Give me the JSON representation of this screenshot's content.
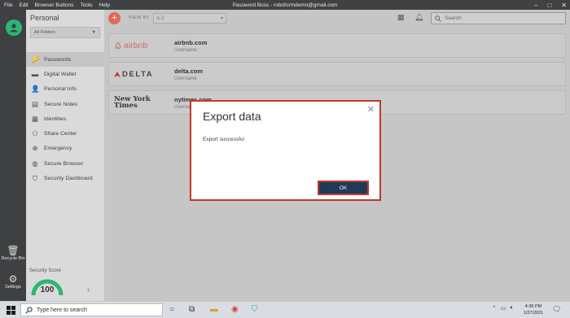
{
  "window": {
    "title": "Password Boss - roboformdemo@gmail.com",
    "menu": [
      "File",
      "Edit",
      "Browser Buttons",
      "Tools",
      "Help"
    ],
    "controls": [
      "–",
      "□",
      "✕"
    ]
  },
  "rail": {
    "recycle_label": "Recycle Bin",
    "settings_label": "Settings"
  },
  "sidebar": {
    "title": "Personal",
    "folder_filter": "All Folders",
    "items": [
      {
        "label": "Passwords",
        "icon": "key-icon",
        "glyph": "🔑",
        "active": true
      },
      {
        "label": "Digital Wallet",
        "icon": "wallet-icon",
        "glyph": "▬"
      },
      {
        "label": "Personal Info",
        "icon": "person-icon",
        "glyph": "👤"
      },
      {
        "label": "Secure Notes",
        "icon": "note-icon",
        "glyph": "▤"
      },
      {
        "label": "Identities",
        "icon": "id-card-icon",
        "glyph": "▦"
      },
      {
        "label": "Share Center",
        "icon": "share-icon",
        "glyph": "⚇"
      },
      {
        "label": "Emergency",
        "icon": "lifebuoy-icon",
        "glyph": "⊕"
      },
      {
        "label": "Secure Browser",
        "icon": "globe-icon",
        "glyph": "◍"
      },
      {
        "label": "Security Dashboard",
        "icon": "shield-icon",
        "glyph": "⛉"
      }
    ],
    "security_score_label": "Security Score",
    "security_score": "100",
    "security_score_fraction": 1.0
  },
  "toolbar": {
    "add_label": "+",
    "view_by_label": "VIEW BY",
    "sort_value": "A-Z",
    "search_placeholder": "Search"
  },
  "entries": [
    {
      "logo": "airbnb",
      "name": "airbnb.com",
      "user": "Username"
    },
    {
      "logo": "DELTA",
      "name": "delta.com",
      "user": "Username"
    },
    {
      "logo_line1": "New York",
      "logo_line2": "Times",
      "name": "nytimes.com",
      "user": "Username"
    }
  ],
  "dialog": {
    "title": "Export data",
    "message": "Export successful",
    "ok_label": "OK",
    "close_glyph": "✕"
  },
  "taskbar": {
    "search_placeholder": "Type here to search",
    "time": "4:36 PM",
    "date": "1/27/2021"
  },
  "colors": {
    "accent": "#2bb673",
    "add_button": "#e06a58",
    "dialog_border": "#c0392b",
    "ok_button": "#1f3b57"
  }
}
